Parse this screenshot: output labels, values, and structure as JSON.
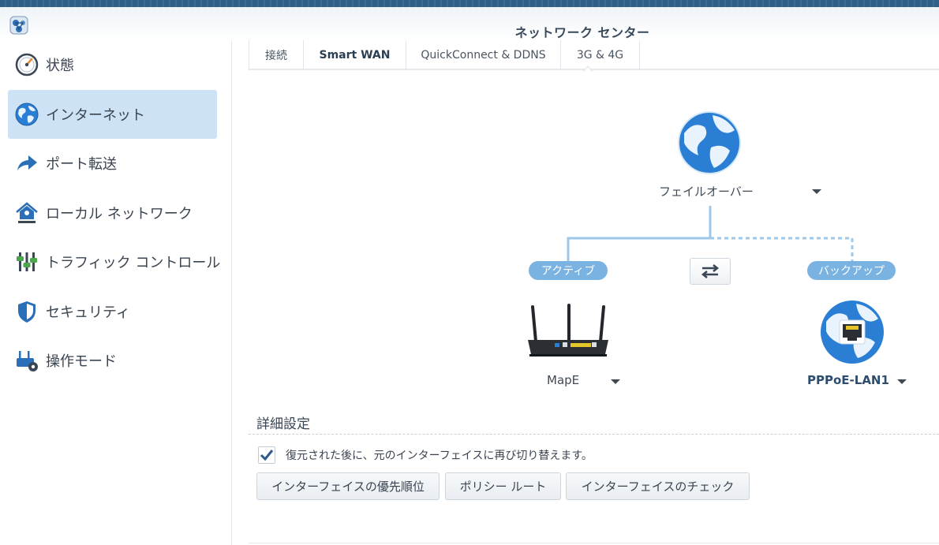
{
  "window": {
    "title": "ネットワーク センター",
    "app_icon": "network-center-icon"
  },
  "sidebar": {
    "items": [
      {
        "label": "状態",
        "icon": "gauge-icon",
        "active": false
      },
      {
        "label": "インターネット",
        "icon": "globe-icon",
        "active": true
      },
      {
        "label": "ポート転送",
        "icon": "forward-arrow-icon",
        "active": false
      },
      {
        "label": "ローカル ネットワーク",
        "icon": "home-network-icon",
        "active": false
      },
      {
        "label": "トラフィック コントロール",
        "icon": "sliders-icon",
        "active": false
      },
      {
        "label": "セキュリティ",
        "icon": "shield-icon",
        "active": false
      },
      {
        "label": "操作モード",
        "icon": "router-gear-icon",
        "active": false
      }
    ]
  },
  "tabs": [
    {
      "label": "接続",
      "active": false
    },
    {
      "label": "Smart WAN",
      "active": true
    },
    {
      "label": "QuickConnect & DDNS",
      "active": false
    },
    {
      "label": "3G & 4G",
      "active": false
    }
  ],
  "diagram": {
    "mode_label": "フェイルオーバー",
    "active_pill": "アクティブ",
    "backup_pill": "バックアップ",
    "primary_interface": "MapE",
    "backup_interface": "PPPoE-LAN1"
  },
  "advanced": {
    "title": "詳細設定",
    "switch_back_label": "復元された後に、元のインターフェイスに再び切り替えます。",
    "switch_back_checked": true,
    "buttons": {
      "priority": "インターフェイスの優先順位",
      "policy_route": "ポリシー ルート",
      "interface_check": "インターフェイスのチェック"
    }
  },
  "colors": {
    "accent": "#cde2f5",
    "pill": "#7ab3e2",
    "globe_ocean": "#2a7fd4",
    "connector": "#9ec8ea"
  }
}
